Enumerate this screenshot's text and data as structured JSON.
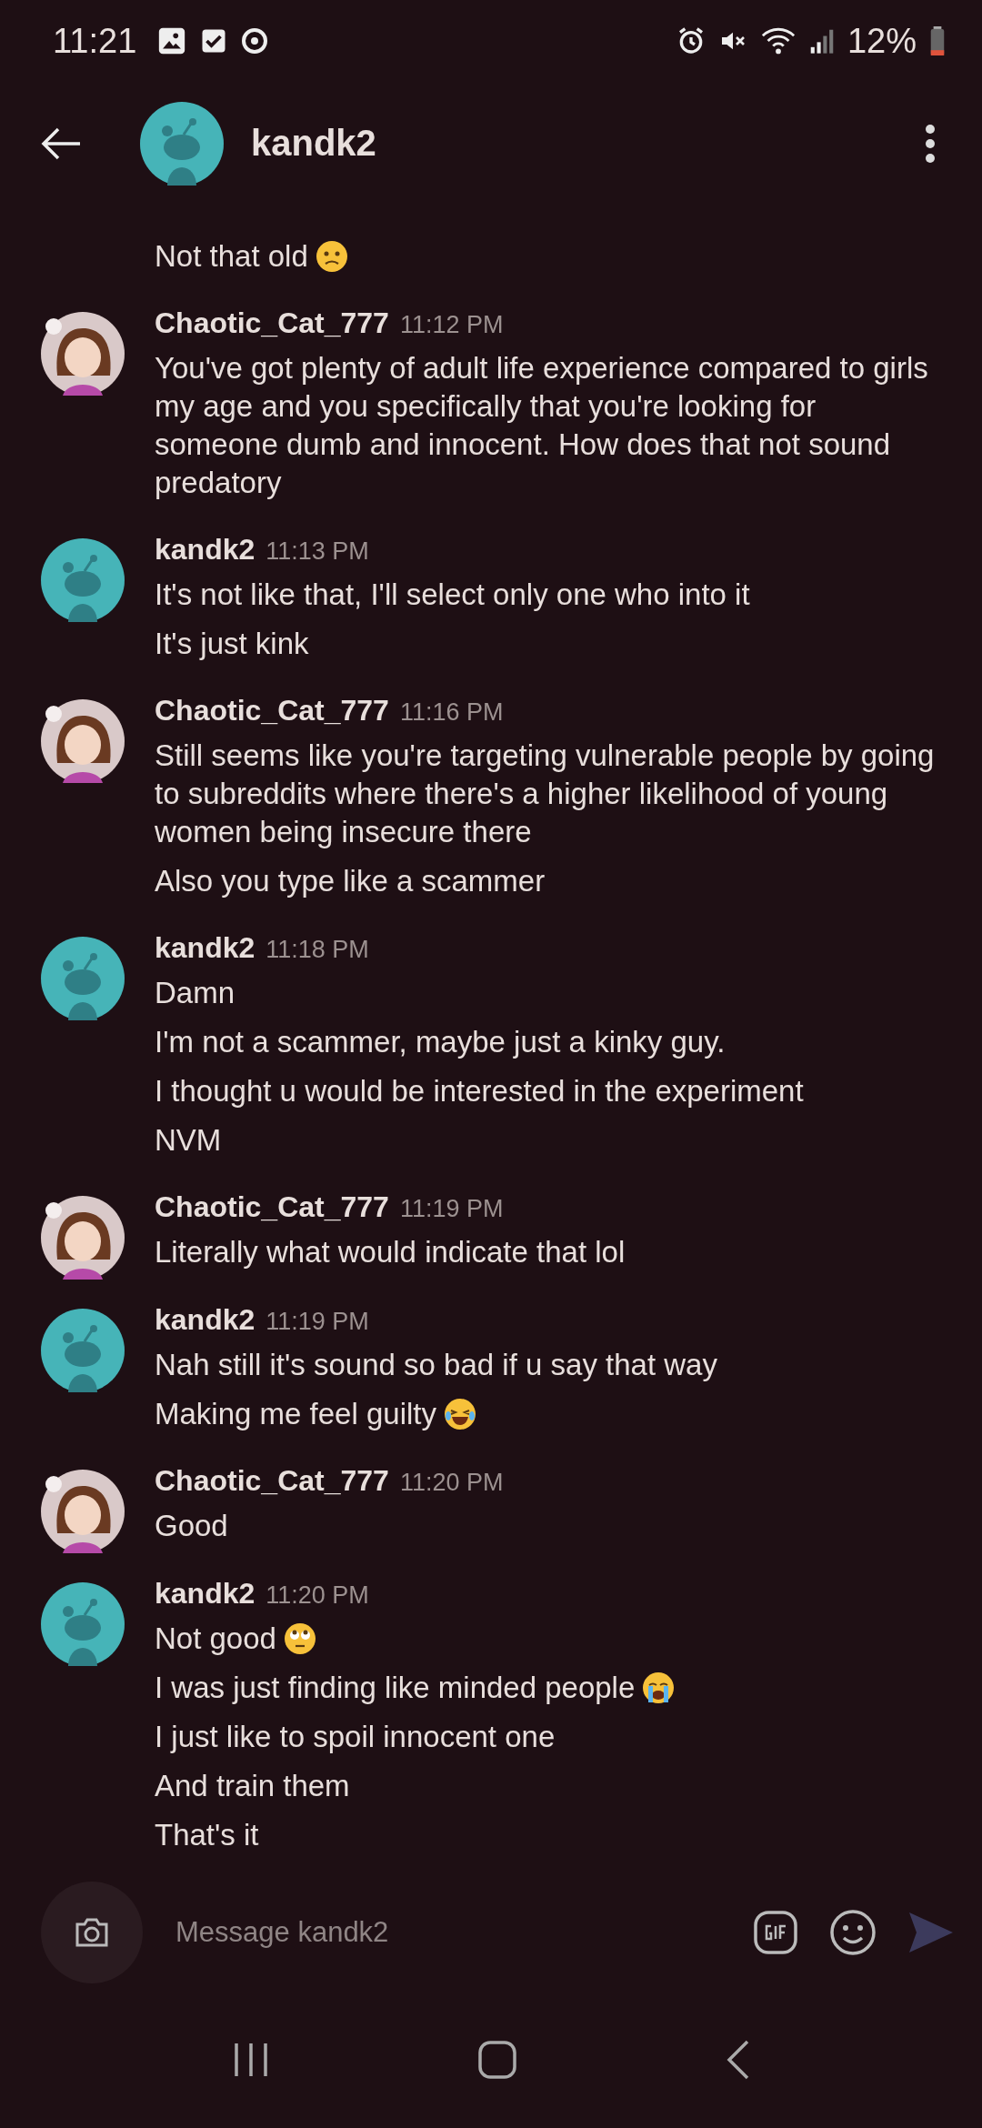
{
  "status_bar": {
    "time": "11:21",
    "battery": "12%"
  },
  "header": {
    "title": "kandk2"
  },
  "messages": [
    {
      "kind": "continuation",
      "lines": [
        {
          "text": "Not that old",
          "kind": "confused"
        }
      ]
    },
    {
      "author": "Chaotic_Cat_777",
      "kind": "girl",
      "time": "11:12 PM",
      "lines": [
        {
          "text": "You've got plenty of adult life experience compared to girls my age and you specifically that you're looking for someone dumb and innocent. How does that not sound predatory",
          "kind": "plain"
        }
      ]
    },
    {
      "author": "kandk2",
      "kind": "snoo",
      "time": "11:13 PM",
      "lines": [
        {
          "text": "It's not like that, I'll select only one who into it",
          "kind": "plain"
        },
        {
          "text": "It's just kink",
          "kind": "plain"
        }
      ]
    },
    {
      "author": "Chaotic_Cat_777",
      "kind": "girl",
      "time": "11:16 PM",
      "lines": [
        {
          "text": "Still seems like you're targeting vulnerable people by going to subreddits where there's a higher likelihood of young women being insecure there",
          "kind": "plain"
        },
        {
          "text": "Also you type like a scammer",
          "kind": "plain"
        }
      ]
    },
    {
      "author": "kandk2",
      "kind": "snoo",
      "time": "11:18 PM",
      "lines": [
        {
          "text": "Damn",
          "kind": "plain"
        },
        {
          "text": "I'm not a scammer, maybe just a kinky guy.",
          "kind": "plain"
        },
        {
          "text": "I thought u would be interested in the experiment",
          "kind": "plain"
        },
        {
          "text": "NVM",
          "kind": "plain"
        }
      ]
    },
    {
      "author": "Chaotic_Cat_777",
      "kind": "girl",
      "time": "11:19 PM",
      "lines": [
        {
          "text": "Literally what would indicate that lol",
          "kind": "plain"
        }
      ]
    },
    {
      "author": "kandk2",
      "kind": "snoo",
      "time": "11:19 PM",
      "lines": [
        {
          "text": "Nah still it's sound so bad if u say that way",
          "kind": "plain"
        },
        {
          "text": "Making me feel guilty",
          "kind": "laughing"
        }
      ]
    },
    {
      "author": "Chaotic_Cat_777",
      "kind": "girl",
      "time": "11:20 PM",
      "lines": [
        {
          "text": "Good",
          "kind": "plain"
        }
      ]
    },
    {
      "author": "kandk2",
      "kind": "snoo",
      "time": "11:20 PM",
      "lines": [
        {
          "text": "Not good",
          "kind": "eyeroll"
        },
        {
          "text": "I was just finding like minded people",
          "kind": "crying"
        },
        {
          "text": "I just like to spoil innocent one",
          "kind": "plain"
        },
        {
          "text": "And train them",
          "kind": "plain"
        },
        {
          "text": "That's it",
          "kind": "plain"
        }
      ]
    }
  ],
  "composer": {
    "placeholder": "Message kandk2"
  }
}
